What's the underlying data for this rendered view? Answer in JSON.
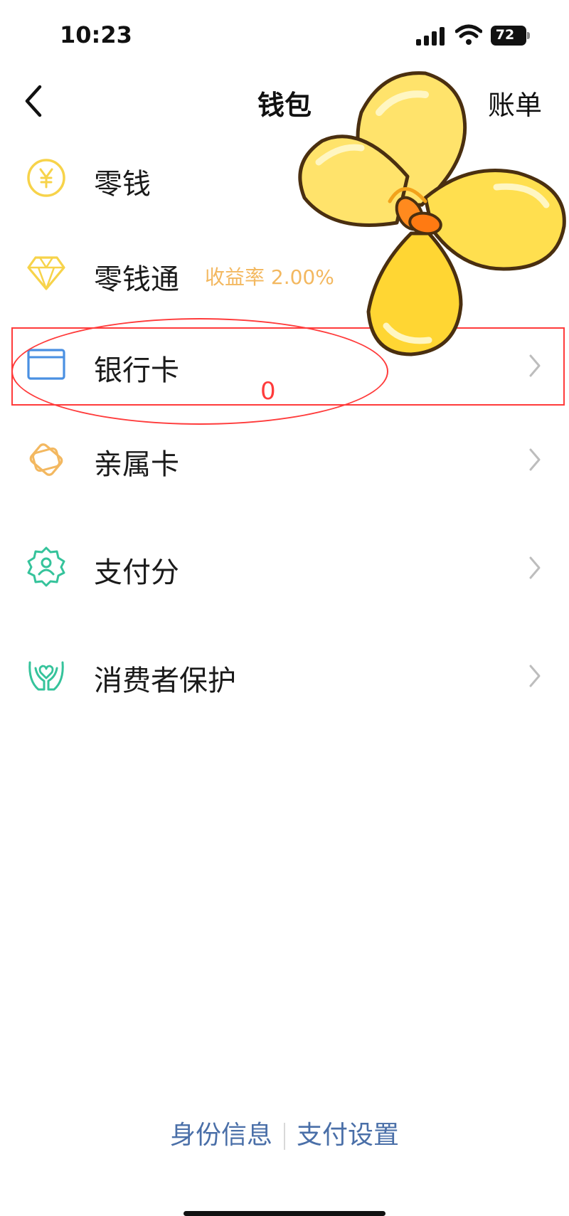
{
  "status_bar": {
    "time": "10:23",
    "battery": "72",
    "icons": [
      "signal-icon",
      "wifi-icon",
      "battery-icon"
    ]
  },
  "nav": {
    "title": "钱包",
    "right_label": "账单",
    "back_icon": "chevron-left-icon"
  },
  "menu": [
    {
      "label": "零钱",
      "icon": "yuan-coin-icon"
    },
    {
      "label": "零钱通",
      "sub": "收益率 2.00%",
      "icon": "diamond-icon"
    },
    {
      "label": "银行卡",
      "icon": "bank-card-icon"
    },
    {
      "label": "亲属卡",
      "icon": "family-card-icon"
    },
    {
      "label": "支付分",
      "icon": "pay-score-badge-icon"
    },
    {
      "label": "消费者保护",
      "icon": "protect-hands-icon"
    }
  ],
  "annotation": {
    "mark": "0"
  },
  "footer": {
    "left": "身份信息",
    "right": "支付设置"
  },
  "colors": {
    "yellow": "#f7d34a",
    "blue": "#4a90e2",
    "orange": "#f3b860",
    "green": "#35c39b",
    "link": "#4a6fa8",
    "annotation": "#ff3b3b"
  }
}
